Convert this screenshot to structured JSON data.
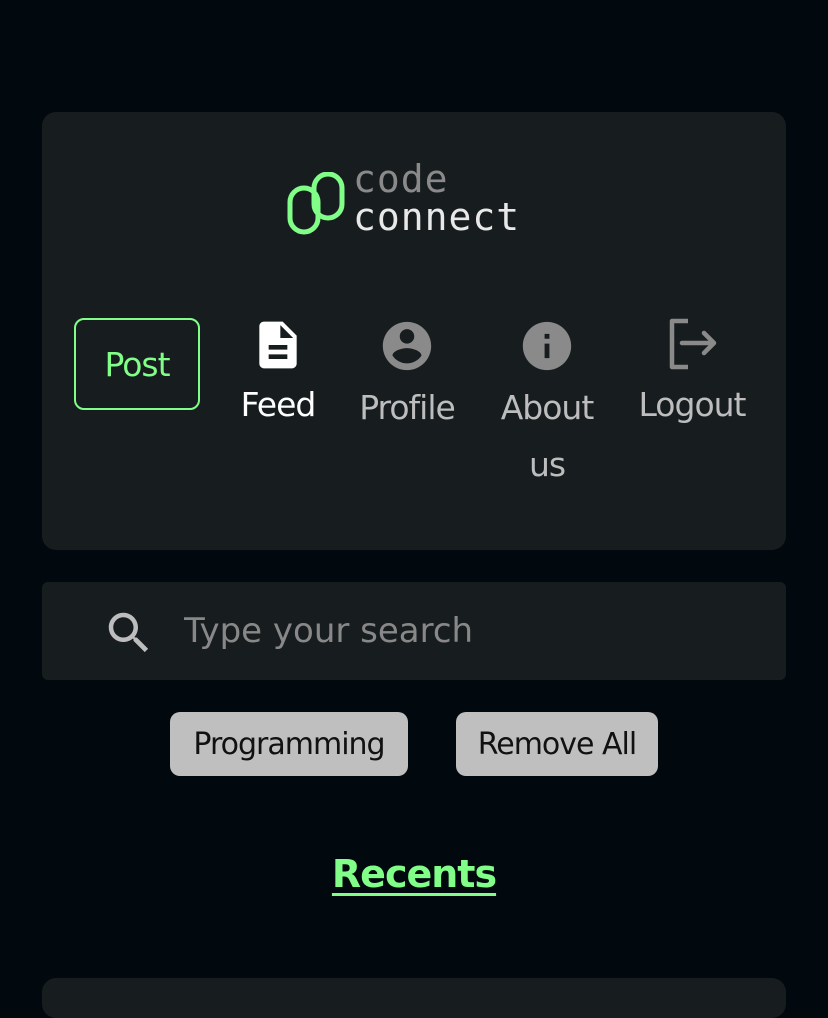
{
  "header": {
    "logo": {
      "word_top": "code",
      "word_bottom": "connect"
    },
    "post_button": "Post",
    "nav": {
      "feed": "Feed",
      "profile": "Profile",
      "about": "About us",
      "logout": "Logout"
    }
  },
  "search": {
    "placeholder": "Type your search",
    "value": ""
  },
  "tags": [
    "Programming"
  ],
  "remove_all_label": "Remove All",
  "recents_heading": "Recents",
  "colors": {
    "accent": "#81fe88",
    "background": "#01080e",
    "card": "#171d1f",
    "tag": "#bfbfbf"
  },
  "icons": {
    "logo": "code-connect-logo-icon",
    "feed": "document-icon",
    "profile": "account-circle-icon",
    "about": "info-icon",
    "logout": "logout-icon",
    "search": "search-icon"
  }
}
